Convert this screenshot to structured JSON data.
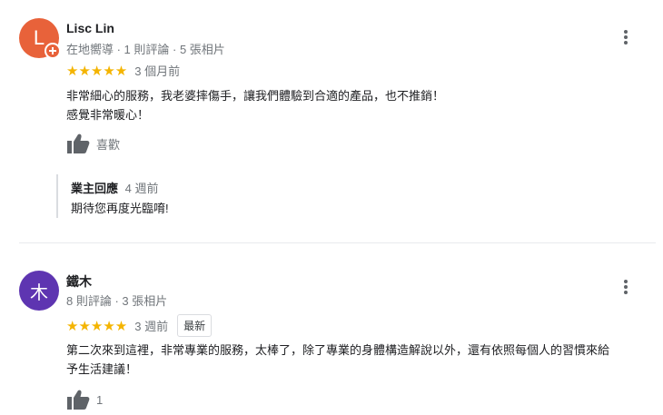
{
  "reviews": [
    {
      "avatar_letter": "L",
      "avatar_color": "#e8623a",
      "name": "Lisc Lin",
      "meta": "在地嚮導 · 1 則評論 · 5 張相片",
      "stars": "★★★★★",
      "rating": 5,
      "time": "3 個月前",
      "text_lines": [
        "非常細心的服務，我老婆摔傷手，讓我們體驗到合適的產品，也不推銷！",
        "感覺非常暖心！"
      ],
      "like_label": "喜歡",
      "reply": {
        "owner_label": "業主回應",
        "time": "4 週前",
        "text": "期待您再度光臨唷!"
      }
    },
    {
      "avatar_letter": "木",
      "avatar_color": "#5e35b1",
      "name": "鐵木",
      "meta": "8 則評論 · 3 張相片",
      "stars": "★★★★★",
      "rating": 5,
      "time": "3 週前",
      "badge": "最新",
      "text_lines": [
        "第二次來到這裡，非常專業的服務，太棒了，除了專業的身體構造解說以外，還有依照每個人的習慣來給",
        "予生活建議！"
      ],
      "like_count": "1"
    }
  ]
}
